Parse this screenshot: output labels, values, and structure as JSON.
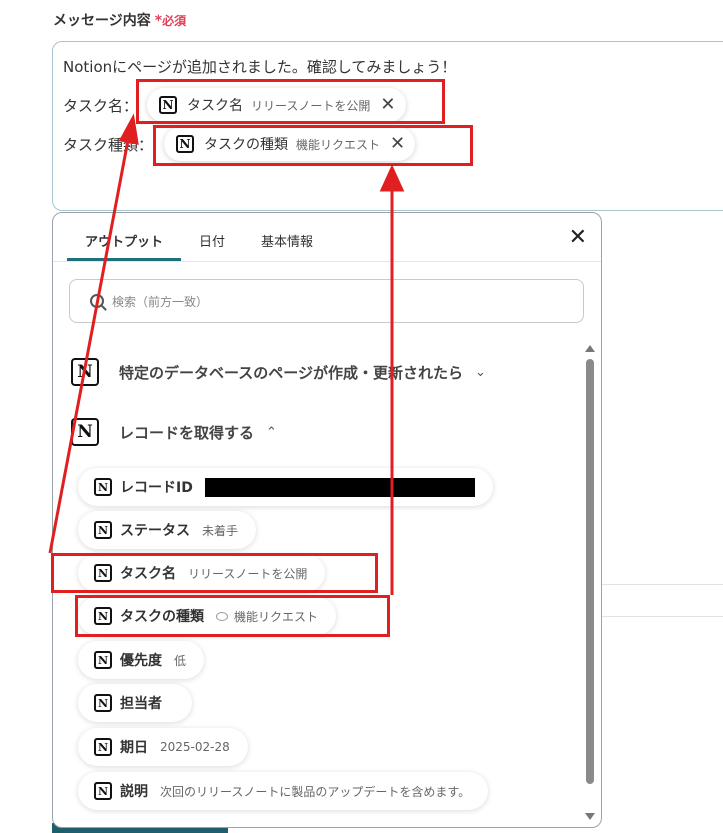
{
  "field": {
    "label": "メッセージ内容",
    "required_star": "*",
    "required_text": "必須"
  },
  "message": {
    "line1": "Notionにページが追加されました。確認してみましょう！",
    "row1_label": "タスク名：",
    "row2_label": "タスク種類：",
    "chip1": {
      "title": "タスク名",
      "value": "リリースノートを公開",
      "close": "✕"
    },
    "chip2": {
      "title": "タスクの種類",
      "value": "機能リクエスト",
      "close": "✕"
    }
  },
  "panel": {
    "tabs": [
      "アウトプット",
      "日付",
      "基本情報"
    ],
    "active_tab": "アウトプット",
    "close": "✕",
    "search_placeholder": "検索（前方一致）",
    "sections": [
      {
        "label": "特定のデータベースのページが作成・更新されたら",
        "chevron": "⌄"
      },
      {
        "label": "レコードを取得する",
        "chevron": "⌃"
      }
    ],
    "items": [
      {
        "title": "レコードID",
        "value": ""
      },
      {
        "title": "ステータス",
        "value": "未着手"
      },
      {
        "title": "タスク名",
        "value": "リリースノートを公開"
      },
      {
        "title": "タスクの種類",
        "value": "機能リクエスト"
      },
      {
        "title": "優先度",
        "value": "低"
      },
      {
        "title": "担当者",
        "value": ""
      },
      {
        "title": "期日",
        "value": "2025-02-28"
      },
      {
        "title": "説明",
        "value": "次回のリリースノートに製品のアップデートを含めます。"
      }
    ]
  },
  "icons": {
    "notion": "N"
  },
  "colors": {
    "accent": "#1f6f7d",
    "required": "#e0405a",
    "highlight": "#e02020"
  }
}
